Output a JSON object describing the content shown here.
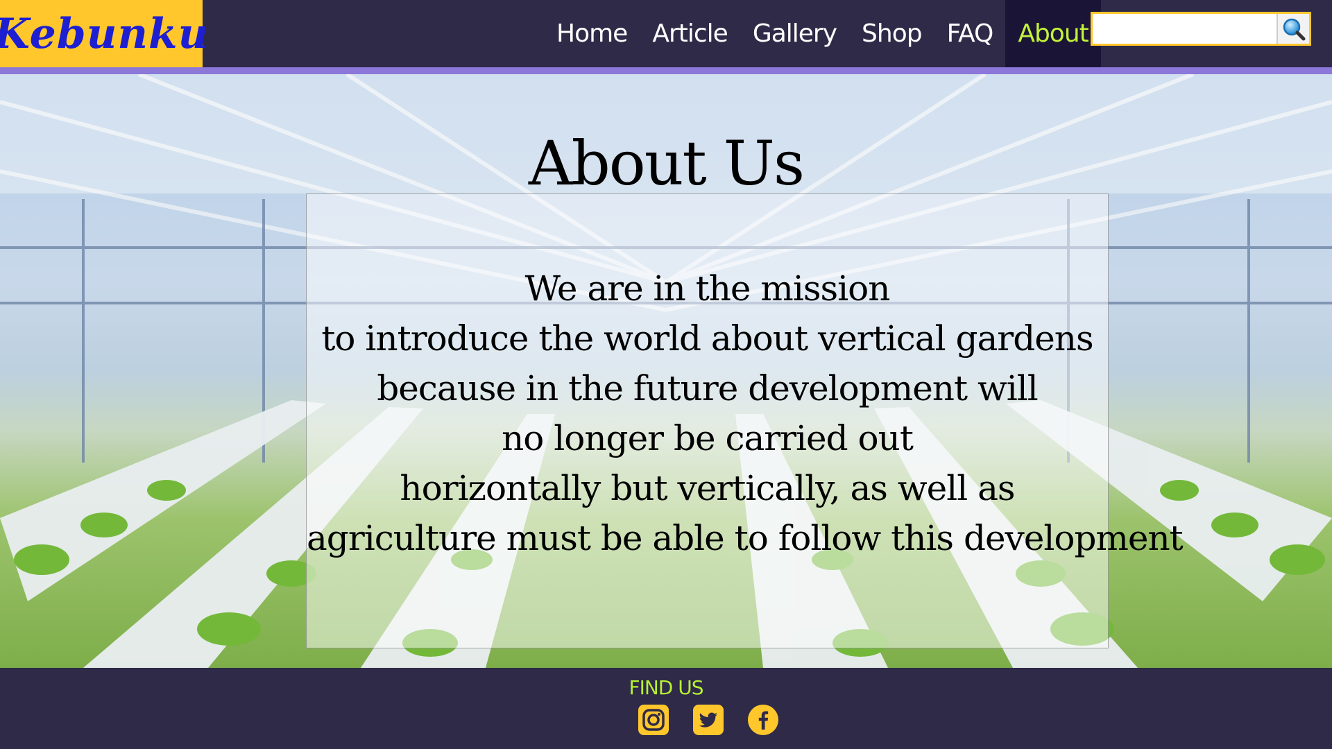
{
  "brand": {
    "name": "Kebunku"
  },
  "nav": {
    "items": [
      {
        "label": "Home"
      },
      {
        "label": "Article"
      },
      {
        "label": "Gallery"
      },
      {
        "label": "Shop"
      },
      {
        "label": "FAQ"
      },
      {
        "label": "About",
        "active": true
      }
    ]
  },
  "search": {
    "value": "",
    "placeholder": "",
    "button_icon": "search-icon"
  },
  "hero": {
    "title": "About Us",
    "mission_lines": [
      "We are in the mission",
      "to introduce the world about vertical gardens",
      "because in the future development will",
      "no longer be carried out",
      "horizontally but vertically, as well as",
      "agriculture must be able to follow this development"
    ]
  },
  "footer": {
    "heading": "FIND US",
    "socials": [
      {
        "icon": "instagram-icon"
      },
      {
        "icon": "twitter-icon"
      },
      {
        "icon": "facebook-icon"
      }
    ]
  },
  "colors": {
    "nav_bg": "#2e2a47",
    "logo_bg": "#ffc72c",
    "logo_text": "#1d1fd1",
    "active_link": "#c3f23a",
    "accent_line": "#8c78d8",
    "find_us": "#b6f034",
    "social_icon": "#ffc72c"
  }
}
